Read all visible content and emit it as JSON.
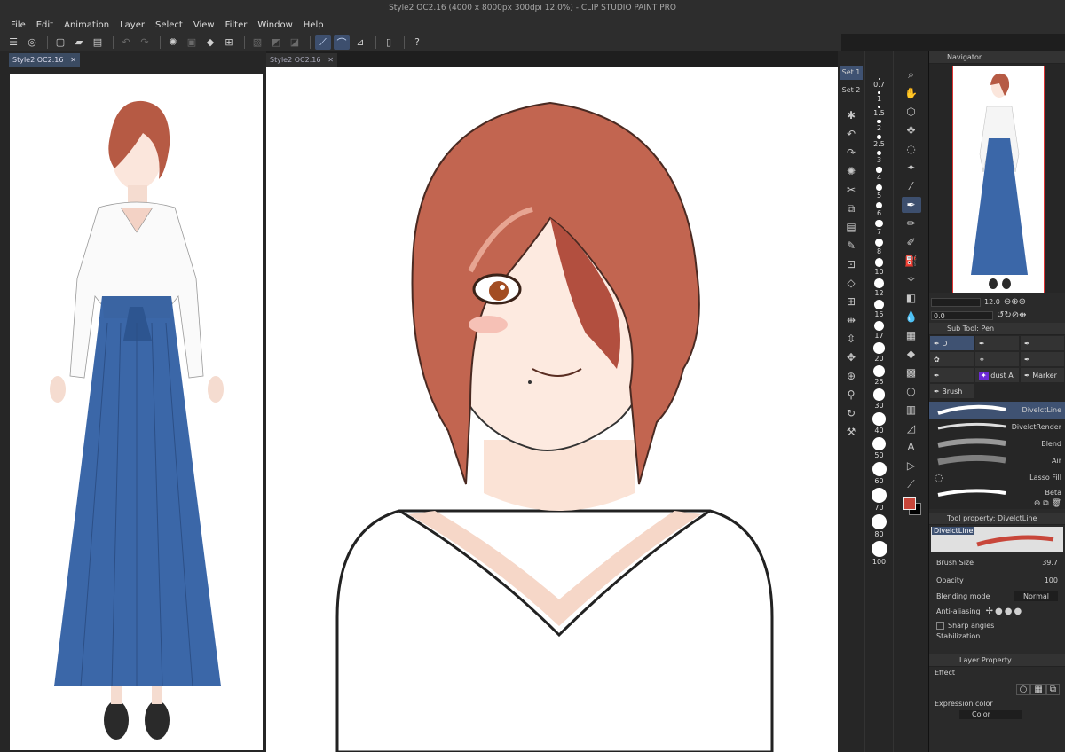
{
  "window": {
    "title": "Style2 OC2.16 (4000 x 8000px 300dpi 12.0%)  - CLIP STUDIO PAINT PRO"
  },
  "menu": [
    "File",
    "Edit",
    "Animation",
    "Layer",
    "Select",
    "View",
    "Filter",
    "Window",
    "Help"
  ],
  "tabs": [
    {
      "label": "Style2 OC2.16",
      "close": "✕"
    },
    {
      "label": "Style2 OC2.16",
      "close": "✕"
    }
  ],
  "tool_sets": [
    "Set 1",
    "Set 2"
  ],
  "brush_sizes": [
    "0.7",
    "1",
    "1.5",
    "2",
    "2.5",
    "3",
    "4",
    "5",
    "6",
    "7",
    "8",
    "10",
    "12",
    "15",
    "17",
    "20",
    "25",
    "30",
    "40",
    "50",
    "60",
    "70",
    "80",
    "100"
  ],
  "navigator": {
    "title": "Navigator",
    "zoom": "12.0",
    "rotate": "0.0"
  },
  "subtool": {
    "title": "Sub Tool: Pen",
    "items": [
      "D",
      "",
      "",
      "",
      "",
      "",
      "",
      "dust",
      "A",
      "Marker",
      "Brush"
    ]
  },
  "brushes": [
    "DivelctLine",
    "DivelctRender",
    "Blend",
    "Air",
    "Lasso Fill",
    "Beta"
  ],
  "tool_property": {
    "title": "Tool property: DivelctLine",
    "preview_label": "DivelctLine",
    "brush_size_label": "Brush Size",
    "brush_size": "39.7",
    "opacity_label": "Opacity",
    "opacity": "100",
    "blending_label": "Blending mode",
    "blending": "Normal",
    "antialias_label": "Anti-aliasing",
    "sharp_label": "Sharp angles",
    "stab_label": "Stabilization"
  },
  "layer_property": {
    "title": "Layer Property",
    "effect": "Effect",
    "expr_label": "Expression color",
    "expr_value": "Color"
  },
  "colors": {
    "main": "#c8463a",
    "sub": "#000000",
    "accent": "#3f5272"
  }
}
